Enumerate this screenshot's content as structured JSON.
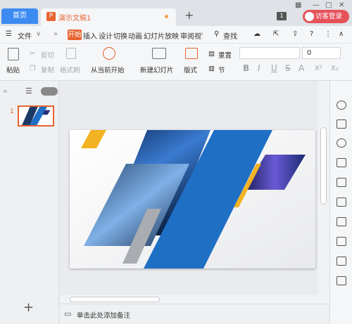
{
  "titlebar": {
    "home_tab": "首页",
    "doc_tab": "演示文稿1",
    "doc_icon": "P",
    "page_count": "1",
    "visitor_btn": "访客登录"
  },
  "menubar": {
    "file": "文件",
    "items": [
      "开始",
      "插入",
      "设计",
      "切换",
      "动画",
      "幻灯片放映",
      "审阅",
      "视"
    ],
    "search": "查找"
  },
  "ribbon": {
    "paste": "粘贴",
    "cut": "剪切",
    "copy": "复制",
    "format_painter": "格式刷",
    "from_current": "从当前开始",
    "new_slide": "新建幻灯片",
    "layout": "版式",
    "reset": "重置",
    "section": "节",
    "font_size": "0",
    "format_buttons": [
      "B",
      "I",
      "U",
      "S",
      "A",
      "X²",
      "X₂"
    ]
  },
  "panel": {
    "slide_number": "1",
    "add_slide": "+"
  },
  "notes": {
    "placeholder": "单击此处添加备注"
  },
  "colors": {
    "accent": "#e8632f",
    "home_tab": "#3d8bf2",
    "visitor": "#e6515a",
    "slide_blue": "#1f6fc5",
    "slide_yellow": "#f2b221"
  }
}
